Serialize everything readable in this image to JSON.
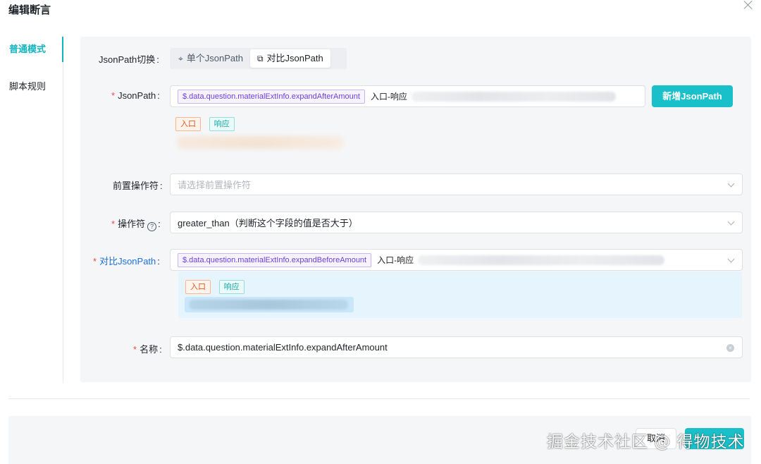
{
  "dialog": {
    "title": "编辑断言"
  },
  "sidebar": {
    "items": [
      {
        "label": "普通模式",
        "active": true
      },
      {
        "label": "脚本规则",
        "active": false
      }
    ]
  },
  "form": {
    "jsonpath_switch": {
      "label": "JsonPath切换",
      "options": [
        {
          "label": "单个JsonPath",
          "icon": "crosshair-icon",
          "selected": false
        },
        {
          "label": "对比JsonPath",
          "icon": "compare-icon",
          "selected": true
        }
      ]
    },
    "jsonpath": {
      "label": "JsonPath",
      "tag": "$.data.question.materialExtInfo.expandAfterAmount",
      "source": "入口-响应",
      "add_button": "新增JsonPath",
      "badges": [
        "入口",
        "响应"
      ]
    },
    "pre_operator": {
      "label": "前置操作符",
      "placeholder": "请选择前置操作符"
    },
    "operator": {
      "label": "操作符",
      "value": "greater_than（判断这个字段的值是否大于）"
    },
    "compare_jsonpath": {
      "label": "对比JsonPath",
      "tag": "$.data.question.materialExtInfo.expandBeforeAmount",
      "source": "入口-响应",
      "badges": [
        "入口",
        "响应"
      ]
    },
    "name": {
      "label": "名称",
      "value": "$.data.question.materialExtInfo.expandAfterAmount"
    }
  },
  "footer": {
    "cancel": "取消",
    "watermark": "掘金技术社区 @ 得物技术"
  },
  "colors": {
    "accent": "#19c0c9",
    "required": "#f54a45"
  }
}
